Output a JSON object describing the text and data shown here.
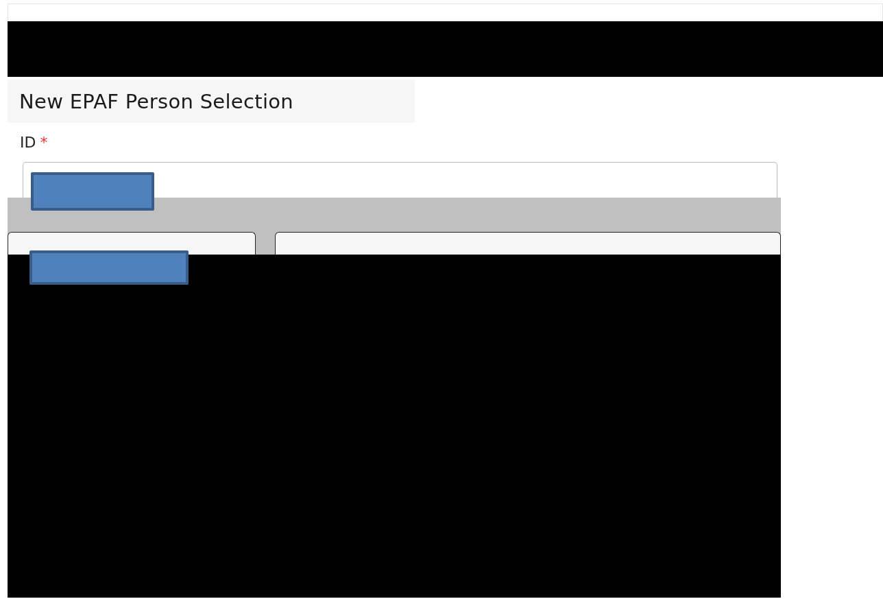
{
  "page": {
    "title": "New EPAF Person Selection"
  },
  "id_field": {
    "label": "ID",
    "required_mark": "*"
  }
}
